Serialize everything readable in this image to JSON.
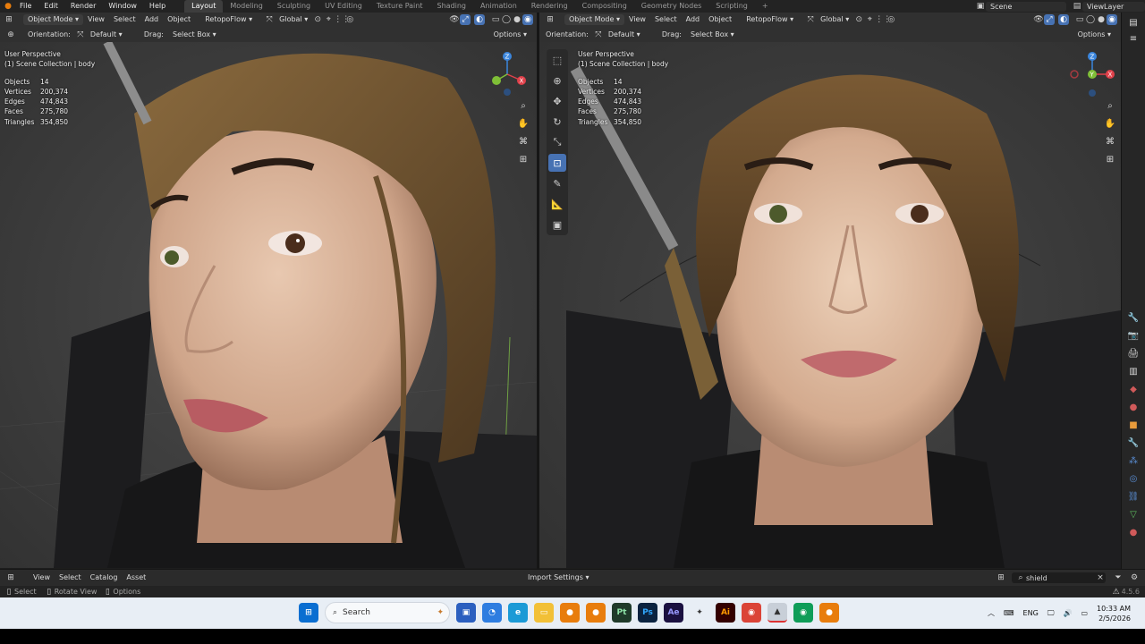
{
  "menubar": {
    "items": [
      "File",
      "Edit",
      "Render",
      "Window",
      "Help"
    ],
    "workspaces": [
      "Layout",
      "Modeling",
      "Sculpting",
      "UV Editing",
      "Texture Paint",
      "Shading",
      "Animation",
      "Rendering",
      "Compositing",
      "Geometry Nodes",
      "Scripting"
    ],
    "active_workspace": "Layout",
    "add_tab": "+",
    "scene": "Scene",
    "view_layer": "ViewLayer"
  },
  "left_header": {
    "mode": "Object Mode",
    "menus": [
      "View",
      "Select",
      "Add",
      "Object"
    ],
    "addon": "RetopoFlow",
    "transform": "Global",
    "orientation_label": "Orientation:",
    "orientation_value": "Default",
    "drag_label": "Drag:",
    "drag_value": "Select Box",
    "options": "Options"
  },
  "right_header": {
    "mode": "Object Mode",
    "menus": [
      "View",
      "Select",
      "Add",
      "Object"
    ],
    "addon": "RetopoFlow",
    "transform": "Global",
    "orientation_label": "Orientation:",
    "orientation_value": "Default",
    "drag_label": "Drag:",
    "drag_value": "Select Box",
    "options": "Options"
  },
  "viewport_left": {
    "perspective": "User Perspective",
    "collection": "(1) Scene Collection | body",
    "stats": [
      {
        "label": "Objects",
        "value": "14"
      },
      {
        "label": "Vertices",
        "value": "200,374"
      },
      {
        "label": "Edges",
        "value": "474,843"
      },
      {
        "label": "Faces",
        "value": "275,780"
      },
      {
        "label": "Triangles",
        "value": "354,850"
      }
    ]
  },
  "viewport_right": {
    "perspective": "User Perspective",
    "collection": "(1) Scene Collection | body",
    "stats": [
      {
        "label": "Objects",
        "value": "14"
      },
      {
        "label": "Vertices",
        "value": "200,374"
      },
      {
        "label": "Edges",
        "value": "474,843"
      },
      {
        "label": "Faces",
        "value": "275,780"
      },
      {
        "label": "Triangles",
        "value": "354,850"
      }
    ]
  },
  "gizmo": {
    "x": "X",
    "y": "Y",
    "z": "Z"
  },
  "asset_bar": {
    "menus": [
      "View",
      "Select",
      "Catalog",
      "Asset"
    ],
    "import": "Import Settings",
    "search_value": "shield"
  },
  "statusbar": {
    "select": "Select",
    "rotate": "Rotate View",
    "options": "Options",
    "version": "4.5.6"
  },
  "taskbar": {
    "search_placeholder": "Search",
    "language": "ENG",
    "time": "10:33 AM",
    "date": "2/5/2026",
    "apps": [
      "Pt",
      "Ps",
      "Ae",
      "Ai"
    ]
  },
  "colors": {
    "accent": "#4772b3",
    "axis_x": "#e0414b",
    "axis_y": "#7fbf37",
    "axis_z": "#3b86dd"
  }
}
